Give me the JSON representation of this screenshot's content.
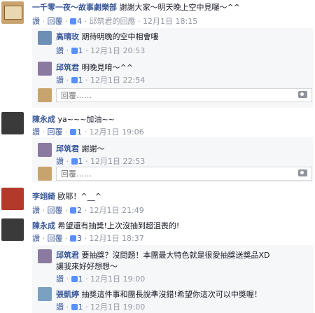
{
  "comments": [
    {
      "name": "一千零一夜～故事劇樂部",
      "text": "謝謝大家～明天晚上空中見囉～^^",
      "like": "讚",
      "reply": "回覆",
      "likes": "4",
      "extra": "邱筑君的回應",
      "time": "12月1日 18:15"
    },
    {
      "name": "陳永成",
      "text": "ya~~~加油~~",
      "like": "讚",
      "reply": "回覆",
      "likes": "1",
      "time": "12月1日 19:06"
    },
    {
      "name": "李翊綺",
      "text": "歐耶！^__^",
      "like": "讚",
      "reply": "回覆",
      "likes": "2",
      "time": "12月1日 21:49"
    },
    {
      "name": "陳永成",
      "text": "希望還有抽獎!上次沒抽到超沮喪的!",
      "like": "讚",
      "reply": "回覆",
      "likes": "3",
      "time": "12月1日 18:37"
    }
  ],
  "replies": [
    {
      "name": "高晴玫",
      "text": "期待明晚的空中相會嘍",
      "like": "讚",
      "reply": "回覆",
      "likes": "1",
      "time": "12月1日 20:53"
    },
    {
      "name": "邱筑君",
      "text": "明晚見唷～^^",
      "like": "讚",
      "reply": "回覆",
      "likes": "1",
      "time": "12月1日 22:54"
    },
    {
      "name": "邱筑君",
      "text": "謝謝～",
      "like": "讚",
      "reply": "回覆",
      "likes": "1",
      "time": "12月1日 22:53"
    },
    {
      "name": "邱筑君",
      "text": "要抽獎？沒問題！本團最大特色就是很愛抽獎送獎品XD",
      "text2": "讓我來好好想想～",
      "like": "讚",
      "reply": "回覆",
      "likes": "1",
      "time": "12月1日 19:00"
    },
    {
      "name": "張凱婷",
      "text": "抽獎這件事和團長說準沒錯!希望你這次可以中獎喔！",
      "like": "讚",
      "reply": "回覆",
      "likes": "1",
      "time": "12月1日 19:00"
    }
  ],
  "reply_placeholder": "回覆……",
  "colors": {
    "link": "#3b5998",
    "meta": "#9197a3",
    "bg": "#f6f7f9"
  }
}
